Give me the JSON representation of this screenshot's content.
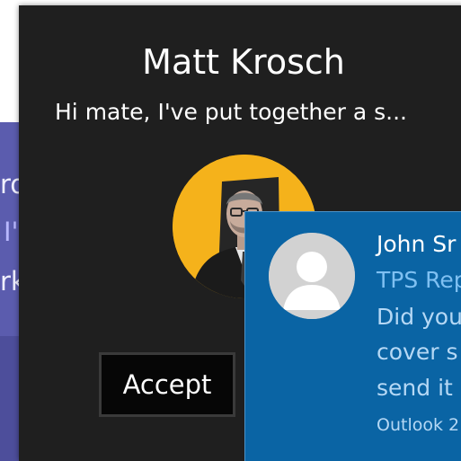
{
  "purple_toast": {
    "fragments": [
      "ro",
      "I'",
      "rk"
    ]
  },
  "call_toast": {
    "caller_name": "Matt Krosch",
    "message": "Hi mate, I've put together a s...",
    "accept_label": "Accept"
  },
  "mail_toast": {
    "sender": "John Sr",
    "subject": "TPS Rep",
    "body_lines": [
      "Did you",
      "cover s",
      "send it"
    ],
    "app_label": "Outlook 2"
  },
  "colors": {
    "call_background": "#1f1f1f",
    "avatar_ring": "#f5b21b",
    "mail_background": "#0a64a4",
    "purple_background": "#5b5cae"
  }
}
